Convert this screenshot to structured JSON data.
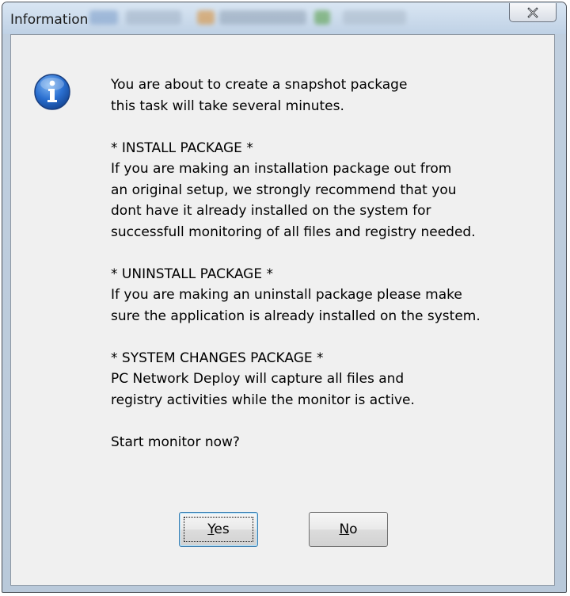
{
  "dialog": {
    "title": "Information",
    "close_glyph": "✕",
    "icon": "information-icon",
    "paragraphs": [
      [
        "You are about to create a snapshot package",
        "this task will take several minutes."
      ],
      [
        "* INSTALL PACKAGE *",
        "If you are making an installation package out from",
        "an original setup, we strongly recommend that you",
        "dont have it already installed on the system for",
        "successfull monitoring of all files and registry needed."
      ],
      [
        "* UNINSTALL PACKAGE *",
        "If you are making an uninstall package please make",
        "sure the application is already installed on the system."
      ],
      [
        "* SYSTEM CHANGES PACKAGE *",
        "PC Network Deploy will capture all files and",
        "registry activities while the monitor is active."
      ],
      [
        "Start monitor now?"
      ]
    ],
    "buttons": {
      "yes_mnemonic": "Y",
      "yes_rest": "es",
      "no_mnemonic": "N",
      "no_rest": "o"
    }
  },
  "colors": {
    "icon_blue": "#1f5fb8",
    "frame": "#bfd1e5"
  }
}
